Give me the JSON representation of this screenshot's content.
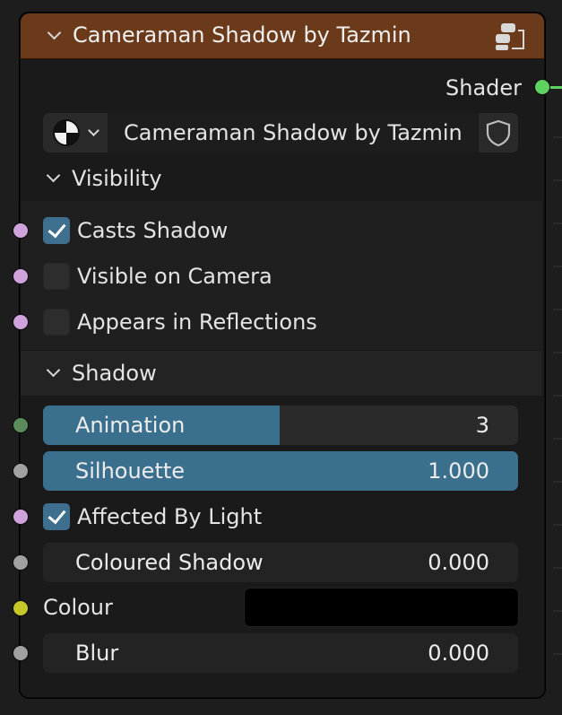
{
  "node": {
    "title": "Cameraman Shadow by Tazmin",
    "header_color": "#6b3a1a"
  },
  "output": {
    "label": "Shader",
    "socket_color": "#5fd35f"
  },
  "datablock": {
    "name": "Cameraman Shadow by Tazmin",
    "type_icon": "node-tree-icon",
    "fake_user_icon": "shield-icon"
  },
  "visibility": {
    "title": "Visibility",
    "items": [
      {
        "label": "Casts Shadow",
        "checked": true
      },
      {
        "label": "Visible on Camera",
        "checked": false
      },
      {
        "label": "Appears in Reflections",
        "checked": false
      }
    ]
  },
  "shadow": {
    "title": "Shadow",
    "animation": {
      "label": "Animation",
      "value": "3",
      "fill_fraction": 0.5
    },
    "silhouette": {
      "label": "Silhouette",
      "value": "1.000",
      "fill_fraction": 1.0
    },
    "affected_by_light": {
      "label": "Affected By Light",
      "checked": true
    },
    "coloured_shadow": {
      "label": "Coloured Shadow",
      "value": "0.000"
    },
    "colour": {
      "label": "Colour",
      "swatch": "#000000"
    },
    "blur": {
      "label": "Blur",
      "value": "0.000"
    }
  },
  "socket_colors": {
    "boolean": "#cfa2dc",
    "integer": "#5b8a5b",
    "float": "#a1a1a1",
    "color": "#c7c72a"
  }
}
